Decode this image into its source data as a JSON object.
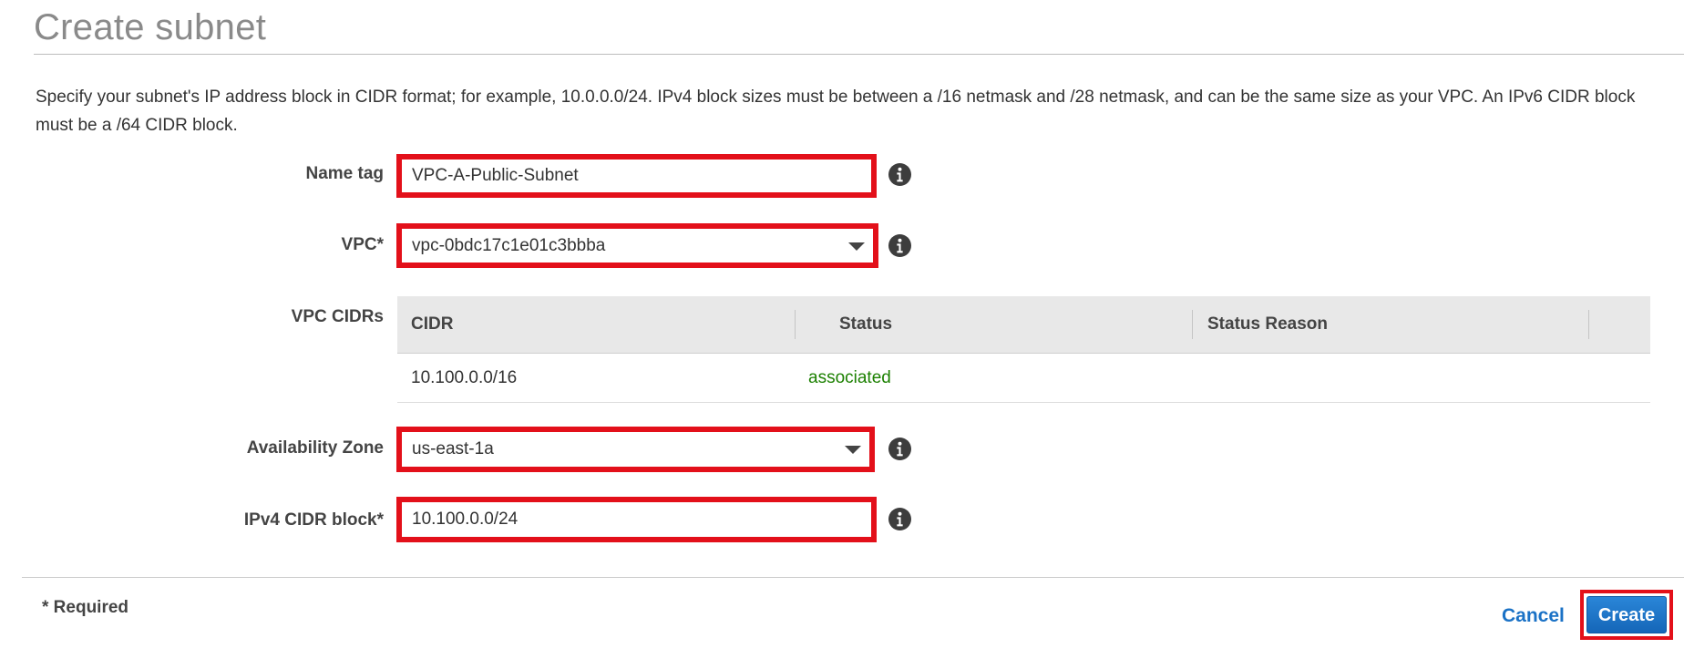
{
  "header": {
    "title": "Create subnet"
  },
  "description": "Specify your subnet's IP address block in CIDR format; for example, 10.0.0.0/24. IPv4 block sizes must be between a /16 netmask and /28 netmask, and can be the same size as your VPC. An IPv6 CIDR block must be a /64 CIDR block.",
  "form": {
    "name_tag": {
      "label": "Name tag",
      "value": "VPC-A-Public-Subnet"
    },
    "vpc": {
      "label": "VPC*",
      "value": "vpc-0bdc17c1e01c3bbba"
    },
    "vpc_cidrs": {
      "label": "VPC CIDRs",
      "columns": [
        "CIDR",
        "Status",
        "Status Reason"
      ],
      "rows": [
        {
          "cidr": "10.100.0.0/16",
          "status": "associated",
          "reason": ""
        }
      ]
    },
    "availability_zone": {
      "label": "Availability Zone",
      "value": "us-east-1a"
    },
    "ipv4_cidr": {
      "label": "IPv4 CIDR block*",
      "value": "10.100.0.0/24"
    }
  },
  "footer": {
    "required_note": "* Required",
    "cancel_label": "Cancel",
    "create_label": "Create"
  },
  "colors": {
    "highlight": "#e3101a",
    "primary": "#1566b8",
    "link": "#1b72c6",
    "status_ok": "#1d8102"
  },
  "icons": {
    "info": "info-icon",
    "dropdown": "chevron-down-icon"
  }
}
